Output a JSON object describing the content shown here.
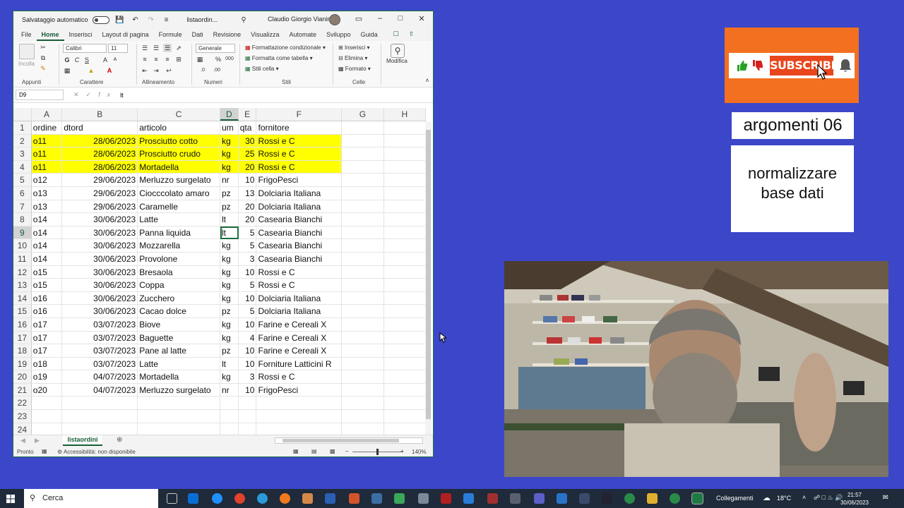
{
  "excel": {
    "autosave_label": "Salvataggio automatico",
    "filename": "listaordin...",
    "user": "Claudio Giorgio Vianini",
    "menu": [
      "File",
      "Home",
      "Inserisci",
      "Layout di pagina",
      "Formule",
      "Dati",
      "Revisione",
      "Visualizza",
      "Automate",
      "Sviluppo",
      "Guida"
    ],
    "ribbon": {
      "paste_label": "Incolla",
      "clipboard_label": "Appunti",
      "font_name": "Calibri",
      "font_size": "11",
      "font_label": "Carattere",
      "align_label": "Allineamento",
      "number_format": "Generale",
      "number_label": "Numeri",
      "cond_format": "Formattazione condizionale",
      "format_table": "Formatta come tabella",
      "cell_styles": "Stili cella",
      "styles_label": "Stili",
      "insert": "Inserisci",
      "delete": "Elimina",
      "format": "Formato",
      "cells_label": "Celle",
      "edit_label": "Modifica"
    },
    "name_box": "D9",
    "formula": "lt",
    "columns": [
      "A",
      "B",
      "C",
      "D",
      "E",
      "F",
      "G",
      "H"
    ],
    "rows": [
      {
        "n": "1",
        "a": "ordine",
        "b": "dtord",
        "c": "articolo",
        "d": "um",
        "e": "qta",
        "f": "fornitore",
        "hl": false
      },
      {
        "n": "2",
        "a": "o11",
        "b": "28/06/2023",
        "c": "Prosciutto cotto",
        "d": "kg",
        "e": "30",
        "f": "Rossi e C",
        "hl": true
      },
      {
        "n": "3",
        "a": "o11",
        "b": "28/06/2023",
        "c": "Prosciutto crudo",
        "d": "kg",
        "e": "25",
        "f": "Rossi e C",
        "hl": true
      },
      {
        "n": "4",
        "a": "o11",
        "b": "28/06/2023",
        "c": "Mortadella",
        "d": "kg",
        "e": "20",
        "f": "Rossi e C",
        "hl": true
      },
      {
        "n": "5",
        "a": "o12",
        "b": "29/06/2023",
        "c": "Merluzzo surgelato",
        "d": "nr",
        "e": "10",
        "f": "FrigoPesci",
        "hl": false
      },
      {
        "n": "6",
        "a": "o13",
        "b": "29/06/2023",
        "c": "Ciocccolato amaro",
        "d": "pz",
        "e": "13",
        "f": "Dolciaria Italiana",
        "hl": false
      },
      {
        "n": "7",
        "a": "o13",
        "b": "29/06/2023",
        "c": "Caramelle",
        "d": "pz",
        "e": "20",
        "f": "Dolciaria Italiana",
        "hl": false
      },
      {
        "n": "8",
        "a": "o14",
        "b": "30/06/2023",
        "c": "Latte",
        "d": "lt",
        "e": "20",
        "f": "Casearia Bianchi",
        "hl": false
      },
      {
        "n": "9",
        "a": "o14",
        "b": "30/06/2023",
        "c": "Panna liquida",
        "d": "lt",
        "e": "5",
        "f": "Casearia Bianchi",
        "hl": false
      },
      {
        "n": "10",
        "a": "o14",
        "b": "30/06/2023",
        "c": "Mozzarella",
        "d": "kg",
        "e": "5",
        "f": "Casearia Bianchi",
        "hl": false
      },
      {
        "n": "11",
        "a": "o14",
        "b": "30/06/2023",
        "c": "Provolone",
        "d": "kg",
        "e": "3",
        "f": "Casearia Bianchi",
        "hl": false
      },
      {
        "n": "12",
        "a": "o15",
        "b": "30/06/2023",
        "c": "Bresaola",
        "d": "kg",
        "e": "10",
        "f": "Rossi e C",
        "hl": false
      },
      {
        "n": "13",
        "a": "o15",
        "b": "30/06/2023",
        "c": "Coppa",
        "d": "kg",
        "e": "5",
        "f": "Rossi e C",
        "hl": false
      },
      {
        "n": "14",
        "a": "o16",
        "b": "30/06/2023",
        "c": "Zucchero",
        "d": "kg",
        "e": "10",
        "f": "Dolciaria Italiana",
        "hl": false
      },
      {
        "n": "15",
        "a": "o16",
        "b": "30/06/2023",
        "c": "Cacao dolce",
        "d": "pz",
        "e": "5",
        "f": "Dolciaria Italiana",
        "hl": false
      },
      {
        "n": "16",
        "a": "o17",
        "b": "03/07/2023",
        "c": "Biove",
        "d": "kg",
        "e": "10",
        "f": "Farine e Cereali X",
        "hl": false
      },
      {
        "n": "17",
        "a": "o17",
        "b": "03/07/2023",
        "c": "Baguette",
        "d": "kg",
        "e": "4",
        "f": "Farine e Cereali X",
        "hl": false
      },
      {
        "n": "18",
        "a": "o17",
        "b": "03/07/2023",
        "c": "Pane al latte",
        "d": "pz",
        "e": "10",
        "f": "Farine e Cereali X",
        "hl": false
      },
      {
        "n": "19",
        "a": "o18",
        "b": "03/07/2023",
        "c": "Latte",
        "d": "lt",
        "e": "10",
        "f": "Forniture Latticini R",
        "hl": false
      },
      {
        "n": "20",
        "a": "o19",
        "b": "04/07/2023",
        "c": "Mortadella",
        "d": "kg",
        "e": "3",
        "f": "Rossi e C",
        "hl": false
      },
      {
        "n": "21",
        "a": "o20",
        "b": "04/07/2023",
        "c": "Merluzzo surgelato",
        "d": "nr",
        "e": "10",
        "f": "FrigoPesci",
        "hl": false
      },
      {
        "n": "22",
        "a": "",
        "b": "",
        "c": "",
        "d": "",
        "e": "",
        "f": "",
        "hl": false
      },
      {
        "n": "23",
        "a": "",
        "b": "",
        "c": "",
        "d": "",
        "e": "",
        "f": "",
        "hl": false
      },
      {
        "n": "24",
        "a": "",
        "b": "",
        "c": "",
        "d": "",
        "e": "",
        "f": "",
        "hl": false
      }
    ],
    "sheet_tab": "listaordini",
    "status_ready": "Pronto",
    "status_access": "Accessibilità: non disponibile",
    "zoom": "140%"
  },
  "overlay": {
    "subscribe_label": "SUBSCRIBED",
    "topic_title": "argomenti 06",
    "topic_subtitle_1": "normalizzare",
    "topic_subtitle_2": "base dati"
  },
  "taskbar": {
    "search_placeholder": "Cerca",
    "network_label": "Collegamenti",
    "temperature": "18°C",
    "time": "21:57",
    "date": "30/06/2023"
  },
  "colors": {
    "excel_green": "#1e6f3f",
    "highlight_yellow": "#ffff00",
    "background_blue": "#3b47c8",
    "subscribe_orange": "#f37021"
  }
}
